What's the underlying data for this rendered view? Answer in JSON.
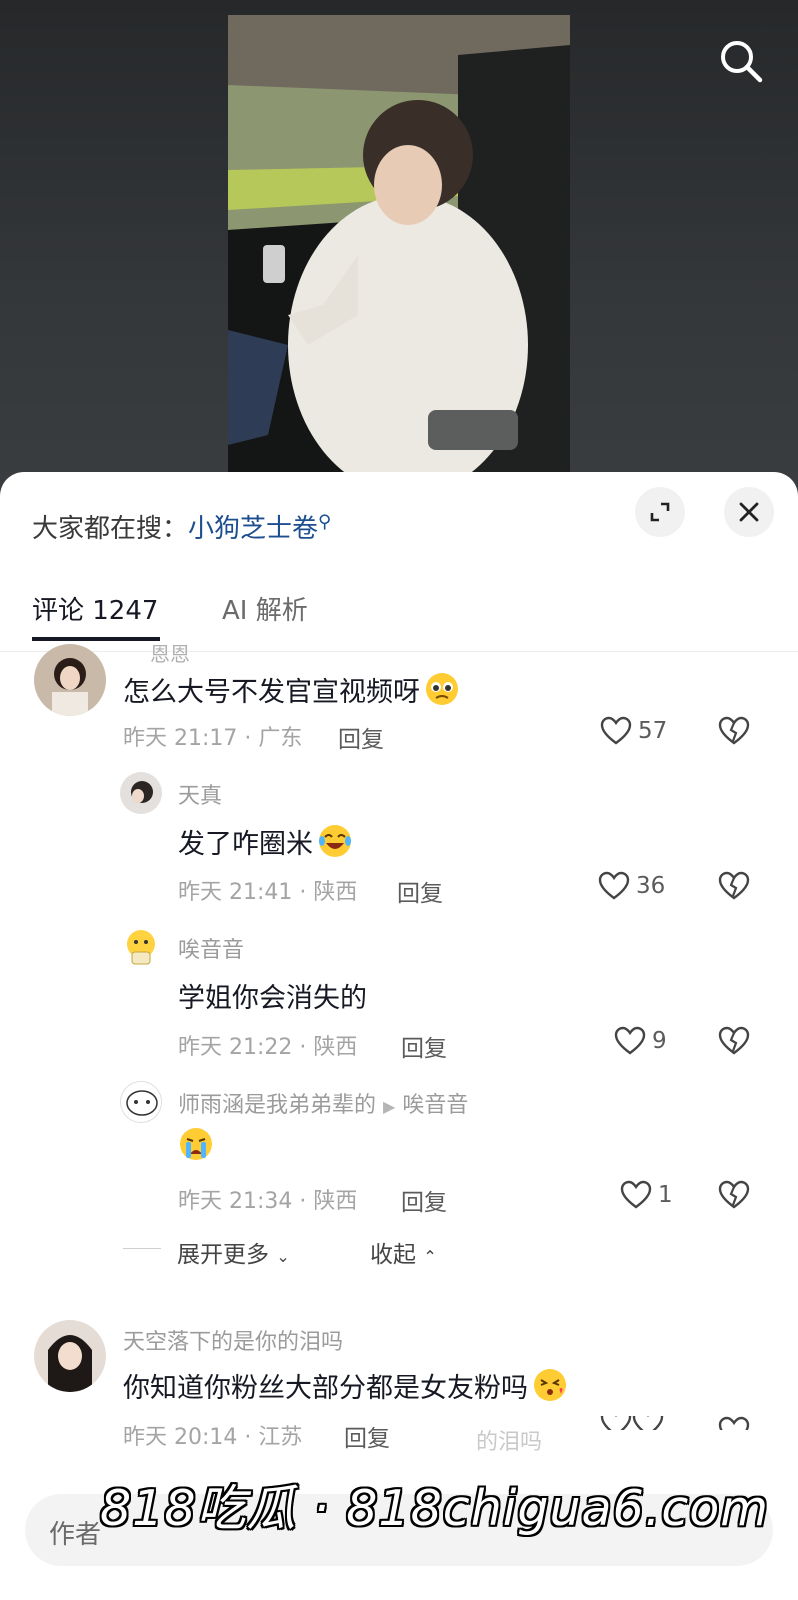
{
  "trending": {
    "prefix": "大家都在搜：",
    "keyword": "小狗芝士卷"
  },
  "tabs": [
    {
      "label": "评论 1247",
      "active": true
    },
    {
      "label": "AI 解析",
      "active": false
    }
  ],
  "comments": [
    {
      "name": "",
      "text": "怎么大号不发官宣视频呀",
      "meta": "昨天 21:17 · 广东",
      "reply_label": "回复",
      "likes": "57",
      "emoji": "pleading-face-icon"
    },
    {
      "name": "天真",
      "text": "发了咋圈米",
      "meta": "昨天 21:41 · 陕西",
      "reply_label": "回复",
      "likes": "36",
      "emoji": "laugh-cry-face-icon"
    },
    {
      "name": "唉音音",
      "text": "学姐你会消失的",
      "meta": "昨天 21:22 · 陕西",
      "reply_label": "回复",
      "likes": "9"
    },
    {
      "name": "师雨涵是我弟弟辈的",
      "reply_to": "唉音音",
      "text": "",
      "meta": "昨天 21:34 · 陕西",
      "reply_label": "回复",
      "likes": "1",
      "emoji": "crying-face-icon"
    },
    {
      "name": "天空落下的是你的泪吗",
      "text": "你知道你粉丝大部分都是女友粉吗",
      "meta": "昨天 20:14 · 江苏",
      "reply_label": "回复",
      "likes": "",
      "emoji": "kissing-face-icon"
    }
  ],
  "thread_controls": {
    "expand": "展开更多",
    "collapse": "收起"
  },
  "faded_text": "的泪吗",
  "input": {
    "placeholder": "作者"
  },
  "watermark": "818吃瓜 · 818chigua6.com",
  "colors": {
    "link": "#1d4e8f",
    "text": "#161823",
    "muted": "#a4a4a4",
    "sheet": "#ffffff"
  }
}
